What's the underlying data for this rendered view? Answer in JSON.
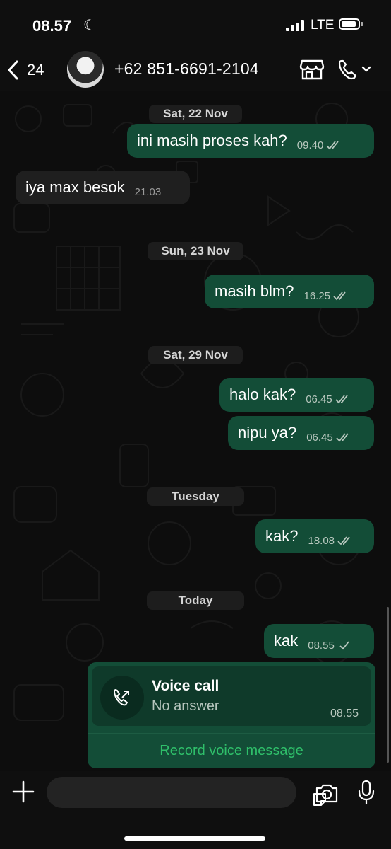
{
  "status_bar": {
    "time": "08.57",
    "network": "LTE"
  },
  "header": {
    "back_count": "24",
    "contact": "+62 851-6691-2104"
  },
  "date_labels": [
    "Sat, 22 Nov",
    "Sun, 23 Nov",
    "Sat, 29 Nov",
    "Tuesday",
    "Today"
  ],
  "messages": [
    {
      "text": "ini masih proses kah?",
      "time": "09.40",
      "direction": "out",
      "status": "read"
    },
    {
      "text": "iya max besok",
      "time": "21.03",
      "direction": "in"
    },
    {
      "text": "masih blm?",
      "time": "16.25",
      "direction": "out",
      "status": "read"
    },
    {
      "text": "halo kak?",
      "time": "06.45",
      "direction": "out",
      "status": "read"
    },
    {
      "text": "nipu ya?",
      "time": "06.45",
      "direction": "out",
      "status": "read"
    },
    {
      "text": "kak?",
      "time": "18.08",
      "direction": "out",
      "status": "read"
    },
    {
      "text": "kak",
      "time": "08.55",
      "direction": "out",
      "status": "sent"
    }
  ],
  "call_card": {
    "title": "Voice call",
    "subtitle": "No answer",
    "time": "08.55",
    "action": "Record voice message"
  },
  "colors": {
    "outgoing_bubble": "#134d37",
    "incoming_bubble": "#1f1f1f",
    "accent_green": "#2fbf6a",
    "background": "#0d0d0d"
  },
  "icons": [
    "back-chevron-icon",
    "store-icon",
    "phone-icon",
    "chevron-down-icon",
    "plus-icon",
    "sticker-icon",
    "camera-icon",
    "mic-icon",
    "missed-call-icon",
    "double-check-icon",
    "single-check-icon",
    "moon-icon",
    "signal-icon",
    "battery-icon"
  ]
}
